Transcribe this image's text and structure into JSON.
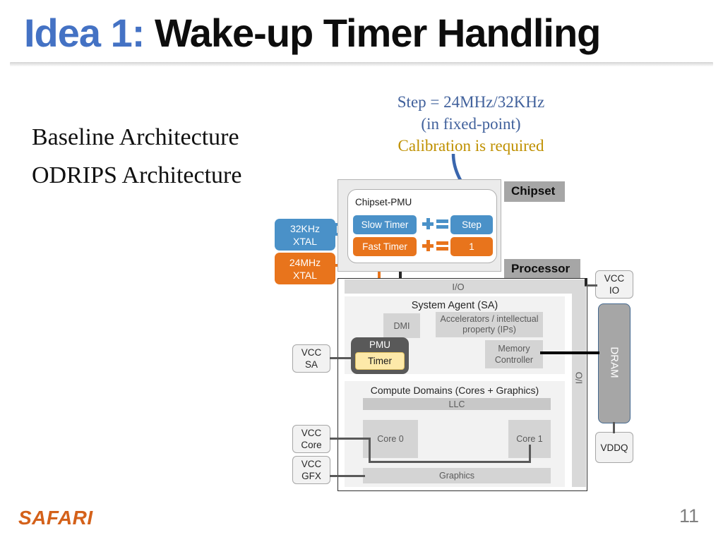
{
  "slide": {
    "title_accent": "Idea 1:",
    "title_main": " Wake-up Timer Handling",
    "page_number": "11",
    "logo": "SAFARI"
  },
  "left_text": {
    "line1": "Baseline Architecture",
    "line2": "ODRIPS Architecture"
  },
  "callout": {
    "line1": "Step = 24MHz/32KHz",
    "line2": "(in fixed-point)",
    "line3": "Calibration is required",
    "line1_color": "#41619c",
    "line3_color": "#bf9000",
    "arrow_color": "#3a66ad"
  },
  "diagram": {
    "chipset_tab": "Chipset",
    "processor_tab": "Processor",
    "chipset_pmu_label": "Chipset-PMU",
    "slow_timer": "Slow Timer",
    "fast_timer": "Fast Timer",
    "step_value": "Step",
    "one_value": "1",
    "xtal_32khz_l1": "32KHz",
    "xtal_32khz_l2": "XTAL",
    "xtal_24mhz_l1": "24MHz",
    "xtal_24mhz_l2": "XTAL",
    "io_top": "I/O",
    "io_right": "I/O",
    "system_agent": "System Agent (SA)",
    "dmi": "DMI",
    "accelerators": "Accelerators / intellectual property (IPs)",
    "memory_controller": "Memory Controller",
    "pmu": "PMU",
    "timer": "Timer",
    "compute_domains": "Compute Domains (Cores + Graphics)",
    "llc": "LLC",
    "core0": "Core 0",
    "core1": "Core 1",
    "graphics": "Graphics",
    "vcc_sa_l1": "VCC",
    "vcc_sa_l2": "SA",
    "vcc_core_l1": "VCC",
    "vcc_core_l2": "Core",
    "vcc_gfx_l1": "VCC",
    "vcc_gfx_l2": "GFX",
    "vcc_io_l1": "VCC",
    "vcc_io_l2": "IO",
    "vddq": "VDDQ",
    "dram": "DRAM",
    "color_blue": "#4a91c8",
    "color_orange": "#e8741c",
    "color_timer_yellow": "#fde9a9",
    "color_pmu_gray": "#595959"
  }
}
